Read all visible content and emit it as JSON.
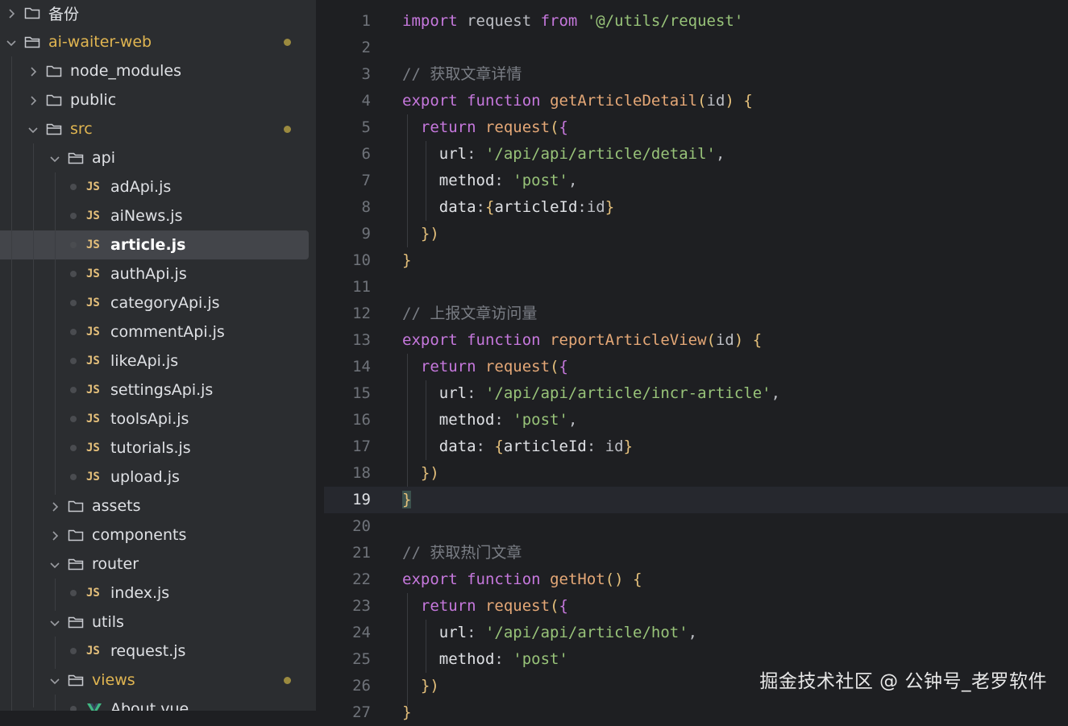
{
  "project_tree": {
    "items": [
      {
        "label": "备份",
        "type": "folder",
        "expanded": false
      },
      {
        "label": "ai-waiter-web",
        "type": "folder",
        "expanded": true,
        "modified": true
      },
      {
        "label": "node_modules",
        "type": "folder",
        "expanded": false
      },
      {
        "label": "public",
        "type": "folder",
        "expanded": false
      },
      {
        "label": "src",
        "type": "folder",
        "expanded": true,
        "modified": true
      },
      {
        "label": "api",
        "type": "folder",
        "expanded": true
      },
      {
        "label": "adApi.js",
        "type": "js"
      },
      {
        "label": "aiNews.js",
        "type": "js"
      },
      {
        "label": "article.js",
        "type": "js",
        "selected": true
      },
      {
        "label": "authApi.js",
        "type": "js"
      },
      {
        "label": "categoryApi.js",
        "type": "js"
      },
      {
        "label": "commentApi.js",
        "type": "js"
      },
      {
        "label": "likeApi.js",
        "type": "js"
      },
      {
        "label": "settingsApi.js",
        "type": "js"
      },
      {
        "label": "toolsApi.js",
        "type": "js"
      },
      {
        "label": "tutorials.js",
        "type": "js"
      },
      {
        "label": "upload.js",
        "type": "js"
      },
      {
        "label": "assets",
        "type": "folder",
        "expanded": false
      },
      {
        "label": "components",
        "type": "folder",
        "expanded": false
      },
      {
        "label": "router",
        "type": "folder",
        "expanded": true
      },
      {
        "label": "index.js",
        "type": "js"
      },
      {
        "label": "utils",
        "type": "folder",
        "expanded": true
      },
      {
        "label": "request.js",
        "type": "js"
      },
      {
        "label": "views",
        "type": "folder",
        "expanded": true,
        "modified": true
      },
      {
        "label": "About.vue",
        "type": "vue"
      }
    ],
    "js_badge": "JS"
  },
  "editor": {
    "current_line": 19,
    "lines": [
      {
        "n": "1",
        "t": "import request from '@/utils/request'"
      },
      {
        "n": "2",
        "t": ""
      },
      {
        "n": "3",
        "t": "// 获取文章详情"
      },
      {
        "n": "4",
        "t": "export function getArticleDetail(id) {"
      },
      {
        "n": "5",
        "t": "  return request({"
      },
      {
        "n": "6",
        "t": "    url: '/api/api/article/detail',"
      },
      {
        "n": "7",
        "t": "    method: 'post',"
      },
      {
        "n": "8",
        "t": "    data:{articleId:id}"
      },
      {
        "n": "9",
        "t": "  })"
      },
      {
        "n": "10",
        "t": "}"
      },
      {
        "n": "11",
        "t": ""
      },
      {
        "n": "12",
        "t": "// 上报文章访问量"
      },
      {
        "n": "13",
        "t": "export function reportArticleView(id) {"
      },
      {
        "n": "14",
        "t": "  return request({"
      },
      {
        "n": "15",
        "t": "    url: '/api/api/article/incr-article',"
      },
      {
        "n": "16",
        "t": "    method: 'post',"
      },
      {
        "n": "17",
        "t": "    data: {articleId: id}"
      },
      {
        "n": "18",
        "t": "  })"
      },
      {
        "n": "19",
        "t": "}"
      },
      {
        "n": "20",
        "t": ""
      },
      {
        "n": "21",
        "t": "// 获取热门文章"
      },
      {
        "n": "22",
        "t": "export function getHot() {"
      },
      {
        "n": "23",
        "t": "  return request({"
      },
      {
        "n": "24",
        "t": "    url: '/api/api/article/hot',"
      },
      {
        "n": "25",
        "t": "    method: 'post'"
      },
      {
        "n": "26",
        "t": "  })"
      },
      {
        "n": "27",
        "t": "}"
      }
    ]
  },
  "watermark": "掘金技术社区 @ 公钟号_老罗软件",
  "colors": {
    "sidebar_bg": "#2b2d30",
    "editor_bg": "#1e1f22",
    "keyword": "#c678dd",
    "function": "#e5a877",
    "string": "#98c379",
    "comment": "#7a7e85",
    "modified": "#e0b551"
  }
}
